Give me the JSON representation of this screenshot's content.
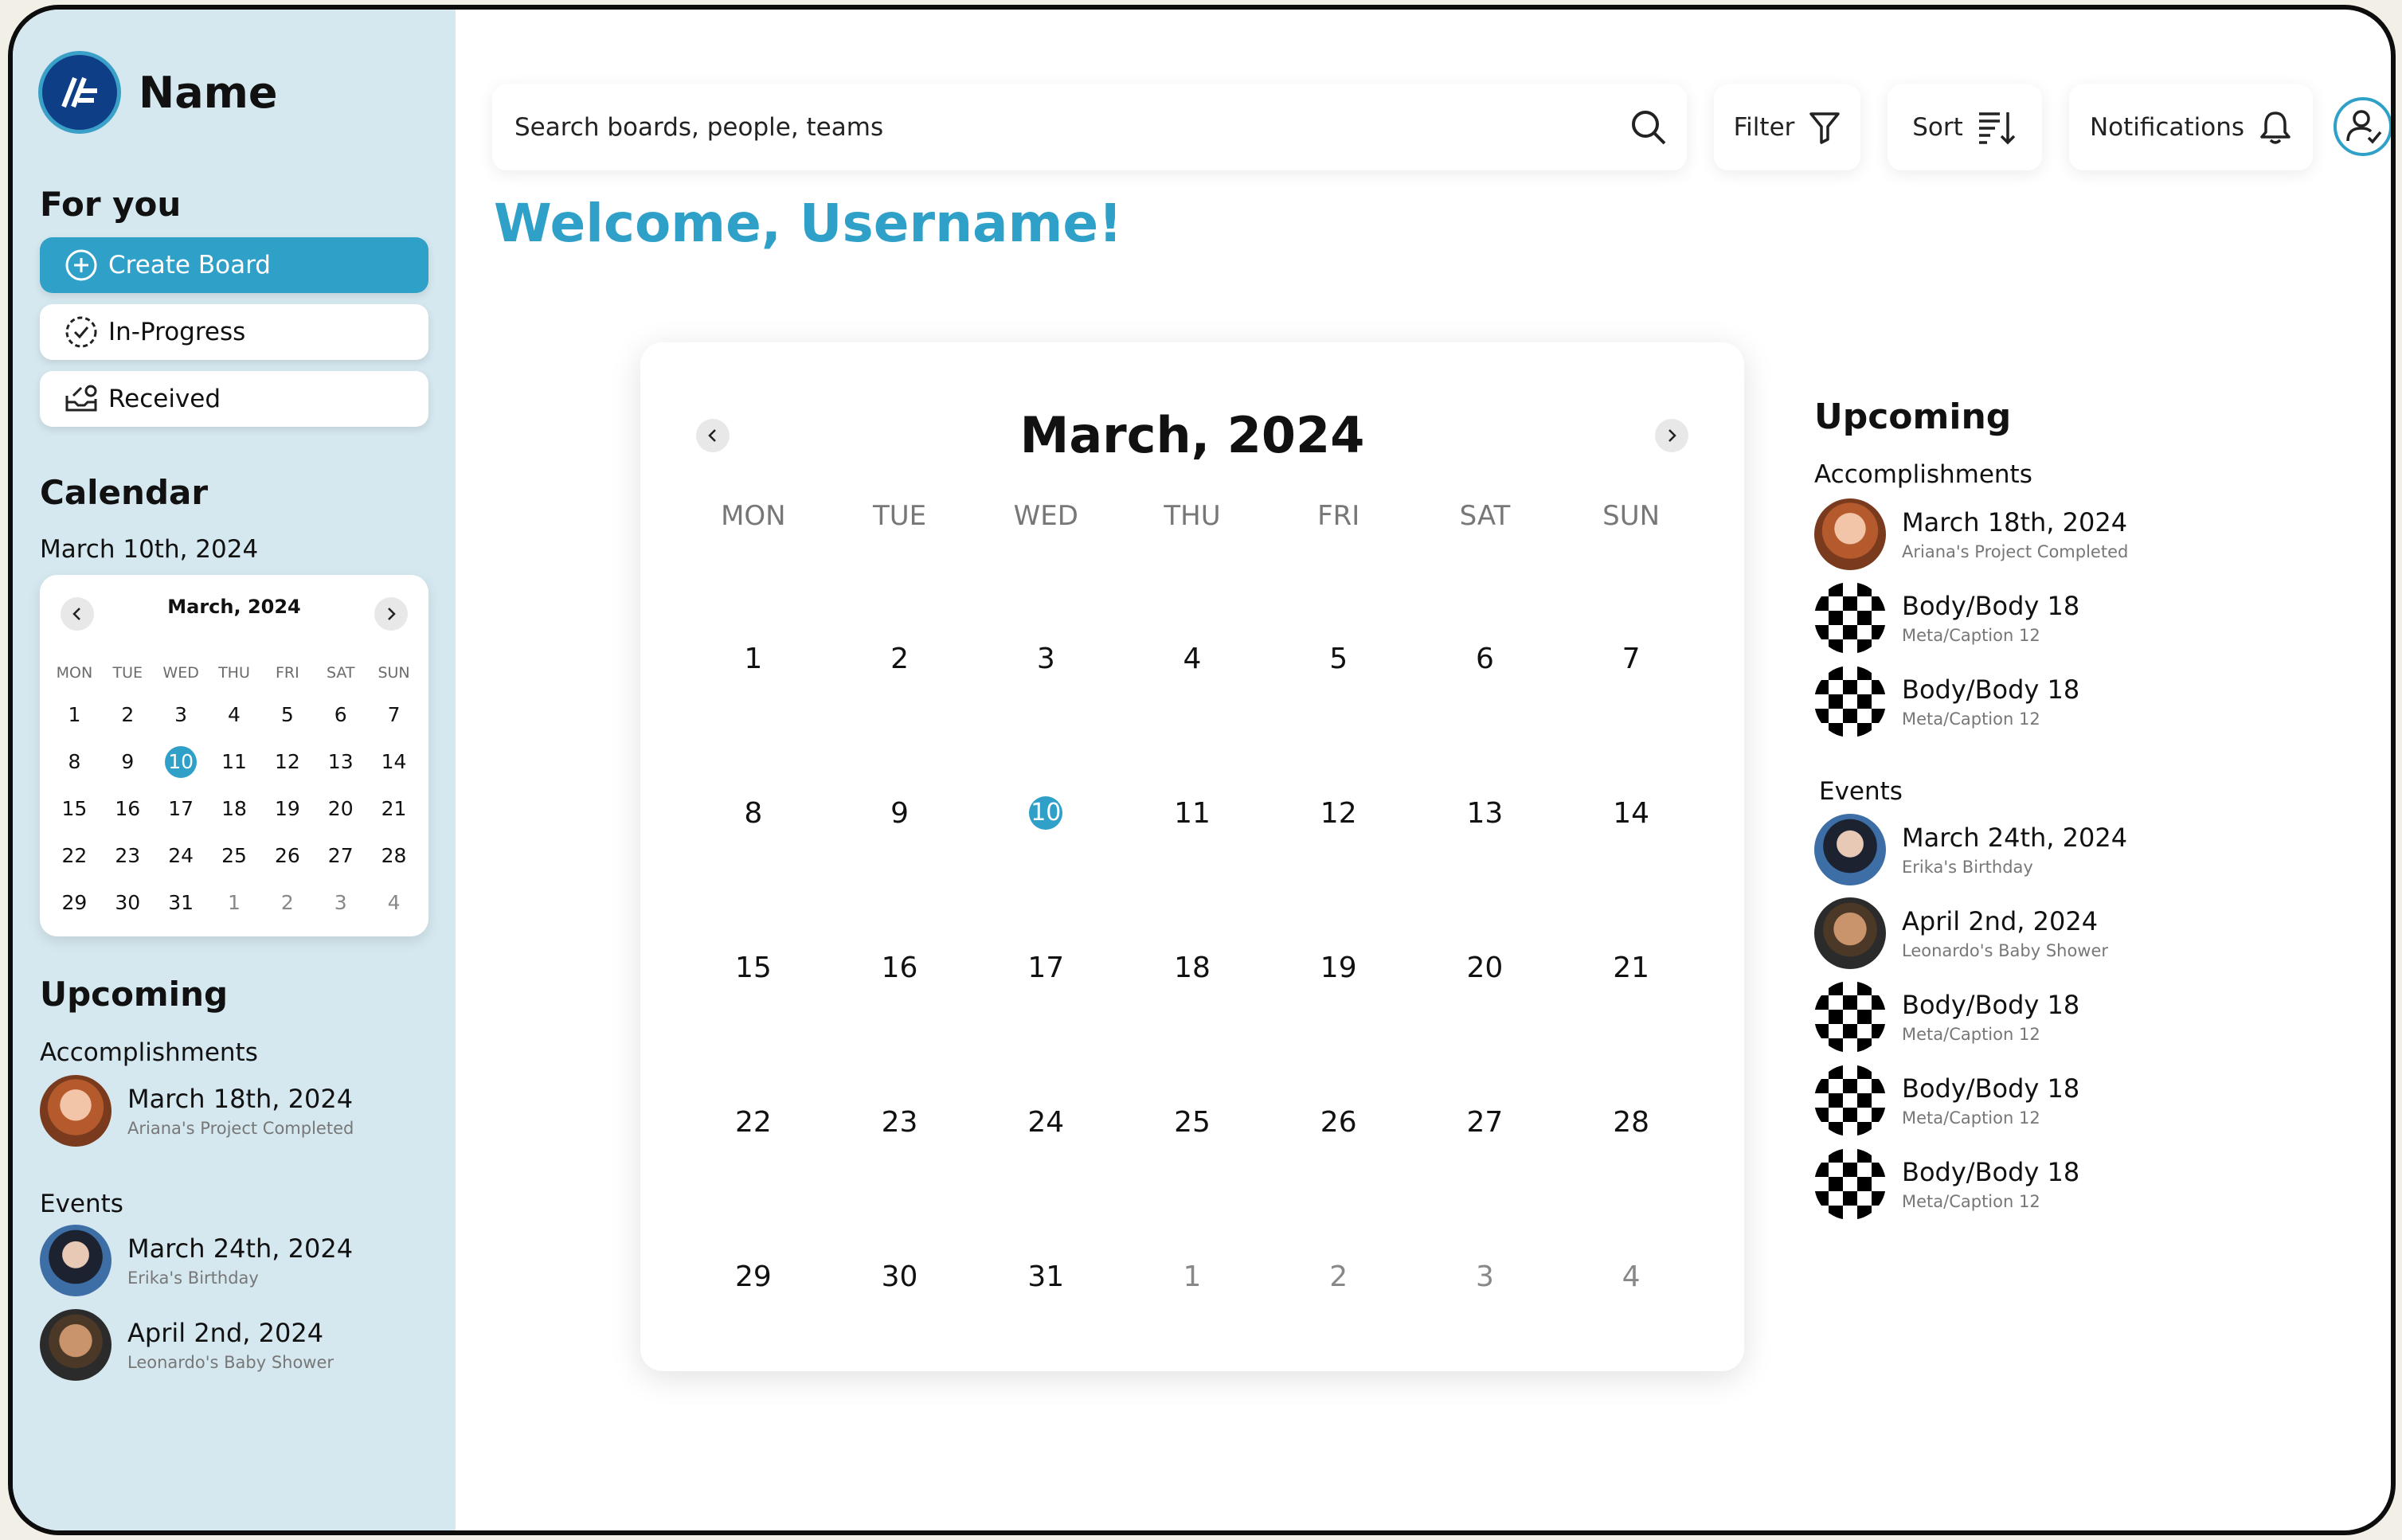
{
  "brand": {
    "name": "Name"
  },
  "sidebar": {
    "for_you_title": "For you",
    "buttons": [
      {
        "label": "Create Board",
        "icon": "plus-circle-icon"
      },
      {
        "label": "In-Progress",
        "icon": "progress-check-icon"
      },
      {
        "label": "Received",
        "icon": "inbox-icon"
      }
    ],
    "calendar_title": "Calendar",
    "selected_date": "March 10th, 2024",
    "mini_calendar": {
      "month": "March, 2024",
      "weekdays": [
        "MON",
        "TUE",
        "WED",
        "THU",
        "FRI",
        "SAT",
        "SUN"
      ],
      "days": [
        "1",
        "2",
        "3",
        "4",
        "5",
        "6",
        "7",
        "8",
        "9",
        "10",
        "11",
        "12",
        "13",
        "14",
        "15",
        "16",
        "17",
        "18",
        "19",
        "20",
        "21",
        "22",
        "23",
        "24",
        "25",
        "26",
        "27",
        "28",
        "29",
        "30",
        "31",
        "1",
        "2",
        "3",
        "4"
      ],
      "selected": "10"
    },
    "upcoming": {
      "title": "Upcoming",
      "accomplishments_title": "Accomplishments",
      "accomplishments": [
        {
          "title": "March 18th, 2024",
          "subtitle": "Ariana's Project Completed"
        }
      ],
      "events_title": "Events",
      "events": [
        {
          "title": "March 24th, 2024",
          "subtitle": "Erika's Birthday"
        },
        {
          "title": "April 2nd, 2024",
          "subtitle": "Leonardo's Baby Shower"
        }
      ]
    }
  },
  "topbar": {
    "search_placeholder": "Search boards, people, teams",
    "filter_label": "Filter",
    "sort_label": "Sort",
    "notifications_label": "Notifications"
  },
  "main": {
    "welcome": "Welcome, Username!",
    "calendar": {
      "month": "March, 2024",
      "weekdays": [
        "MON",
        "TUE",
        "WED",
        "THU",
        "FRI",
        "SAT",
        "SUN"
      ],
      "days": [
        "1",
        "2",
        "3",
        "4",
        "5",
        "6",
        "7",
        "8",
        "9",
        "10",
        "11",
        "12",
        "13",
        "14",
        "15",
        "16",
        "17",
        "18",
        "19",
        "20",
        "21",
        "22",
        "23",
        "24",
        "25",
        "26",
        "27",
        "28",
        "29",
        "30",
        "31",
        "1",
        "2",
        "3",
        "4"
      ],
      "selected": "10"
    }
  },
  "right_panel": {
    "title": "Upcoming",
    "accomplishments_title": "Accomplishments",
    "accomplishments": [
      {
        "title": "March 18th, 2024",
        "subtitle": "Ariana's Project Completed"
      },
      {
        "title": "Body/Body 18",
        "subtitle": "Meta/Caption 12"
      },
      {
        "title": "Body/Body 18",
        "subtitle": "Meta/Caption 12"
      }
    ],
    "events_title": "Events",
    "events": [
      {
        "title": "March 24th, 2024",
        "subtitle": "Erika's Birthday"
      },
      {
        "title": "April 2nd, 2024",
        "subtitle": "Leonardo's Baby Shower"
      },
      {
        "title": "Body/Body 18",
        "subtitle": "Meta/Caption 12"
      },
      {
        "title": "Body/Body 18",
        "subtitle": "Meta/Caption 12"
      },
      {
        "title": "Body/Body 18",
        "subtitle": "Meta/Caption 12"
      }
    ]
  },
  "colors": {
    "accent": "#2fa0c8",
    "sidebar_bg": "#d5e8ef",
    "logo": "#0e3f86"
  }
}
